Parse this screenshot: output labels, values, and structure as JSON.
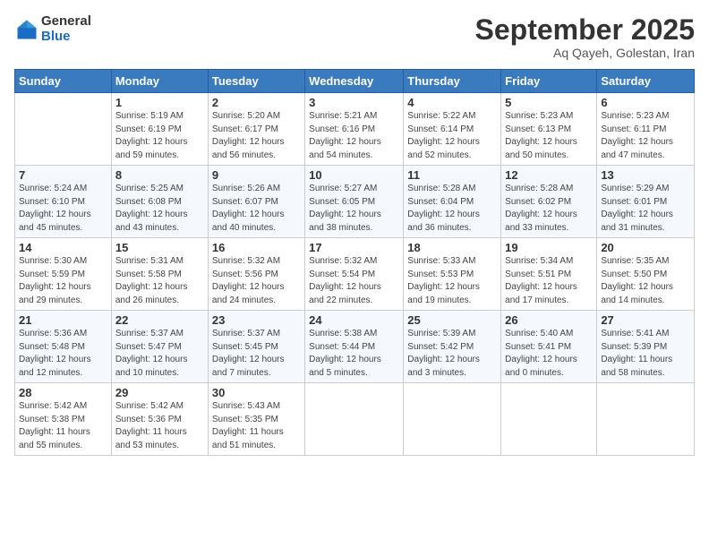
{
  "header": {
    "logo_general": "General",
    "logo_blue": "Blue",
    "month_title": "September 2025",
    "location": "Aq Qayeh, Golestan, Iran"
  },
  "weekdays": [
    "Sunday",
    "Monday",
    "Tuesday",
    "Wednesday",
    "Thursday",
    "Friday",
    "Saturday"
  ],
  "weeks": [
    [
      {
        "day": "",
        "info": ""
      },
      {
        "day": "1",
        "info": "Sunrise: 5:19 AM\nSunset: 6:19 PM\nDaylight: 12 hours\nand 59 minutes."
      },
      {
        "day": "2",
        "info": "Sunrise: 5:20 AM\nSunset: 6:17 PM\nDaylight: 12 hours\nand 56 minutes."
      },
      {
        "day": "3",
        "info": "Sunrise: 5:21 AM\nSunset: 6:16 PM\nDaylight: 12 hours\nand 54 minutes."
      },
      {
        "day": "4",
        "info": "Sunrise: 5:22 AM\nSunset: 6:14 PM\nDaylight: 12 hours\nand 52 minutes."
      },
      {
        "day": "5",
        "info": "Sunrise: 5:23 AM\nSunset: 6:13 PM\nDaylight: 12 hours\nand 50 minutes."
      },
      {
        "day": "6",
        "info": "Sunrise: 5:23 AM\nSunset: 6:11 PM\nDaylight: 12 hours\nand 47 minutes."
      }
    ],
    [
      {
        "day": "7",
        "info": "Sunrise: 5:24 AM\nSunset: 6:10 PM\nDaylight: 12 hours\nand 45 minutes."
      },
      {
        "day": "8",
        "info": "Sunrise: 5:25 AM\nSunset: 6:08 PM\nDaylight: 12 hours\nand 43 minutes."
      },
      {
        "day": "9",
        "info": "Sunrise: 5:26 AM\nSunset: 6:07 PM\nDaylight: 12 hours\nand 40 minutes."
      },
      {
        "day": "10",
        "info": "Sunrise: 5:27 AM\nSunset: 6:05 PM\nDaylight: 12 hours\nand 38 minutes."
      },
      {
        "day": "11",
        "info": "Sunrise: 5:28 AM\nSunset: 6:04 PM\nDaylight: 12 hours\nand 36 minutes."
      },
      {
        "day": "12",
        "info": "Sunrise: 5:28 AM\nSunset: 6:02 PM\nDaylight: 12 hours\nand 33 minutes."
      },
      {
        "day": "13",
        "info": "Sunrise: 5:29 AM\nSunset: 6:01 PM\nDaylight: 12 hours\nand 31 minutes."
      }
    ],
    [
      {
        "day": "14",
        "info": "Sunrise: 5:30 AM\nSunset: 5:59 PM\nDaylight: 12 hours\nand 29 minutes."
      },
      {
        "day": "15",
        "info": "Sunrise: 5:31 AM\nSunset: 5:58 PM\nDaylight: 12 hours\nand 26 minutes."
      },
      {
        "day": "16",
        "info": "Sunrise: 5:32 AM\nSunset: 5:56 PM\nDaylight: 12 hours\nand 24 minutes."
      },
      {
        "day": "17",
        "info": "Sunrise: 5:32 AM\nSunset: 5:54 PM\nDaylight: 12 hours\nand 22 minutes."
      },
      {
        "day": "18",
        "info": "Sunrise: 5:33 AM\nSunset: 5:53 PM\nDaylight: 12 hours\nand 19 minutes."
      },
      {
        "day": "19",
        "info": "Sunrise: 5:34 AM\nSunset: 5:51 PM\nDaylight: 12 hours\nand 17 minutes."
      },
      {
        "day": "20",
        "info": "Sunrise: 5:35 AM\nSunset: 5:50 PM\nDaylight: 12 hours\nand 14 minutes."
      }
    ],
    [
      {
        "day": "21",
        "info": "Sunrise: 5:36 AM\nSunset: 5:48 PM\nDaylight: 12 hours\nand 12 minutes."
      },
      {
        "day": "22",
        "info": "Sunrise: 5:37 AM\nSunset: 5:47 PM\nDaylight: 12 hours\nand 10 minutes."
      },
      {
        "day": "23",
        "info": "Sunrise: 5:37 AM\nSunset: 5:45 PM\nDaylight: 12 hours\nand 7 minutes."
      },
      {
        "day": "24",
        "info": "Sunrise: 5:38 AM\nSunset: 5:44 PM\nDaylight: 12 hours\nand 5 minutes."
      },
      {
        "day": "25",
        "info": "Sunrise: 5:39 AM\nSunset: 5:42 PM\nDaylight: 12 hours\nand 3 minutes."
      },
      {
        "day": "26",
        "info": "Sunrise: 5:40 AM\nSunset: 5:41 PM\nDaylight: 12 hours\nand 0 minutes."
      },
      {
        "day": "27",
        "info": "Sunrise: 5:41 AM\nSunset: 5:39 PM\nDaylight: 11 hours\nand 58 minutes."
      }
    ],
    [
      {
        "day": "28",
        "info": "Sunrise: 5:42 AM\nSunset: 5:38 PM\nDaylight: 11 hours\nand 55 minutes."
      },
      {
        "day": "29",
        "info": "Sunrise: 5:42 AM\nSunset: 5:36 PM\nDaylight: 11 hours\nand 53 minutes."
      },
      {
        "day": "30",
        "info": "Sunrise: 5:43 AM\nSunset: 5:35 PM\nDaylight: 11 hours\nand 51 minutes."
      },
      {
        "day": "",
        "info": ""
      },
      {
        "day": "",
        "info": ""
      },
      {
        "day": "",
        "info": ""
      },
      {
        "day": "",
        "info": ""
      }
    ]
  ]
}
